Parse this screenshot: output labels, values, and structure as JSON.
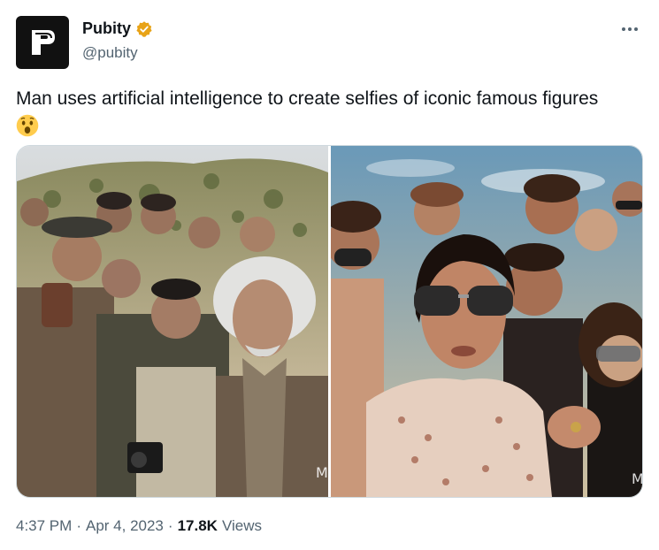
{
  "author": {
    "name": "Pubity",
    "handle": "@pubity",
    "verified_icon": "verified-badge-icon",
    "verified_color": "#f4b400",
    "avatar_letter": "P"
  },
  "more_icon": "more-horizontal-icon",
  "tweet": {
    "text": "Man uses artificial intelligence to create selfies of iconic famous figures",
    "emoji": "astonished-face-emoji"
  },
  "media": {
    "photos": [
      "AI selfie image with Einstein-like figure",
      "AI selfie image with Elvis-like figure"
    ]
  },
  "meta": {
    "time": "4:37 PM",
    "sep1": "·",
    "date": "Apr 4, 2023",
    "sep2": "·",
    "views_count": "17.8K",
    "views_label": "Views"
  },
  "colors": {
    "text_primary": "#0f1419",
    "text_secondary": "#536471",
    "border": "#cfd9de"
  }
}
